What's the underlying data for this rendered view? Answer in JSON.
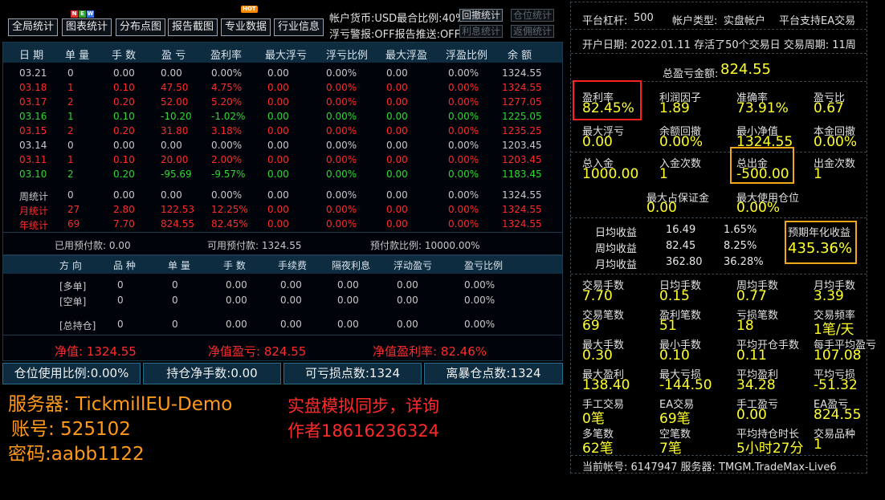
{
  "toolbar": {
    "buttons": [
      "全局统计",
      "图表统计",
      "分布点图",
      "报告截图",
      "专业数据",
      "行业信息"
    ],
    "new_badge": [
      "N",
      "E",
      "W"
    ],
    "hot_badge": "HOT",
    "status1": "帐户货币:USD最合比例:40%",
    "status2": "浮亏警报:OFF报告推送:OFF",
    "btn_rollback": "回撤统计",
    "btn_position": "仓位统计",
    "btn_interest": "利息统计",
    "btn_rebate": "返佣统计"
  },
  "daily": {
    "headers": [
      "日 期",
      "单 量",
      "手 数",
      "盈 亏",
      "盈利率",
      "最大浮亏",
      "浮亏比例",
      "最大浮盈",
      "浮盈比例",
      "余 额"
    ],
    "rows": [
      {
        "date": "03.21",
        "orders": "0",
        "lots": "0.00",
        "pl": "0.00",
        "rate": "0.00%",
        "maxloss": "0.00",
        "lossr": "0.00%",
        "maxprofit": "0.00",
        "profitr": "0.00%",
        "balance": "1324.55",
        "color": "gray"
      },
      {
        "date": "03.18",
        "orders": "1",
        "lots": "0.10",
        "pl": "47.50",
        "rate": "4.75%",
        "maxloss": "0.00",
        "lossr": "0.00%",
        "maxprofit": "0.00",
        "profitr": "0.00%",
        "balance": "1324.55",
        "color": "red"
      },
      {
        "date": "03.17",
        "orders": "2",
        "lots": "0.20",
        "pl": "52.00",
        "rate": "5.20%",
        "maxloss": "0.00",
        "lossr": "0.00%",
        "maxprofit": "0.00",
        "profitr": "0.00%",
        "balance": "1277.05",
        "color": "red"
      },
      {
        "date": "03.16",
        "orders": "1",
        "lots": "0.10",
        "pl": "-10.20",
        "rate": "-1.02%",
        "maxloss": "0.00",
        "lossr": "0.00%",
        "maxprofit": "0.00",
        "profitr": "0.00%",
        "balance": "1225.05",
        "color": "green"
      },
      {
        "date": "03.15",
        "orders": "2",
        "lots": "0.20",
        "pl": "31.80",
        "rate": "3.18%",
        "maxloss": "0.00",
        "lossr": "0.00%",
        "maxprofit": "0.00",
        "profitr": "0.00%",
        "balance": "1235.25",
        "color": "red"
      },
      {
        "date": "03.14",
        "orders": "0",
        "lots": "0.00",
        "pl": "0.00",
        "rate": "0.00%",
        "maxloss": "0.00",
        "lossr": "0.00%",
        "maxprofit": "0.00",
        "profitr": "0.00%",
        "balance": "1203.45",
        "color": "gray"
      },
      {
        "date": "03.11",
        "orders": "1",
        "lots": "0.10",
        "pl": "20.00",
        "rate": "2.00%",
        "maxloss": "0.00",
        "lossr": "0.00%",
        "maxprofit": "0.00",
        "profitr": "0.00%",
        "balance": "1203.45",
        "color": "red"
      },
      {
        "date": "03.10",
        "orders": "2",
        "lots": "0.20",
        "pl": "-95.69",
        "rate": "-9.57%",
        "maxloss": "0.00",
        "lossr": "0.00%",
        "maxprofit": "0.00",
        "profitr": "0.00%",
        "balance": "1183.45",
        "color": "green"
      }
    ],
    "summary": [
      {
        "date": "周统计",
        "orders": "0",
        "lots": "0.00",
        "pl": "0.00",
        "rate": "0.00%",
        "maxloss": "0.00",
        "lossr": "0.00%",
        "maxprofit": "0.00",
        "profitr": "0.00%",
        "balance": "1324.55",
        "color": "gray"
      },
      {
        "date": "月统计",
        "orders": "27",
        "lots": "2.80",
        "pl": "122.53",
        "rate": "12.25%",
        "maxloss": "0.00",
        "lossr": "0.00%",
        "maxprofit": "0.00",
        "profitr": "0.00%",
        "balance": "1324.55",
        "color": "red"
      },
      {
        "date": "年统计",
        "orders": "69",
        "lots": "7.70",
        "pl": "824.55",
        "rate": "82.45%",
        "maxloss": "0.00",
        "lossr": "0.00%",
        "maxprofit": "0.00",
        "profitr": "0.00%",
        "balance": "1324.55",
        "color": "red"
      }
    ],
    "used_prepay": "已用预付款: 0.00",
    "avail_prepay": "可用预付款: 1324.55",
    "prepay_ratio": "预付款比例: 10000.00%"
  },
  "positions": {
    "headers": [
      "方 向",
      "品 种",
      "单 量",
      "手 数",
      "手续费",
      "隔夜利息",
      "浮动盈亏",
      "盈亏比例"
    ],
    "rows": [
      [
        "[多单]",
        "0",
        "0",
        "0.00",
        "0.00",
        "0.00",
        "0.00",
        "0.00%"
      ],
      [
        "[空单]",
        "0",
        "0",
        "0.00",
        "0.00",
        "0.00",
        "0.00",
        "0.00%"
      ],
      [
        "[总持仓]",
        "0",
        "0",
        "0.00",
        "0.00",
        "0.00",
        "0.00",
        "0.00%"
      ]
    ],
    "net_value": "净值: 1324.55",
    "net_pl": "净值盈亏: 824.55",
    "net_rate": "净值盈利率: 82.46%"
  },
  "bottom": {
    "pos_usage": "仓位使用比例:0.00%",
    "net_lots": "持仓净手数:0.00",
    "stop_points": "可亏损点数:1324",
    "blowup_points": "离暴仓点数:1324"
  },
  "overlay": {
    "server": "服务器: TickmillEU-Demo",
    "account": "账号: 525102",
    "password": "密码:aabb1122",
    "promo1": "实盘模拟同步，详询",
    "promo2": "作者18616236324"
  },
  "right": {
    "leverage_label": "平台杠杆:",
    "leverage": "500",
    "acct_type_label": "帐户类型:",
    "acct_type": "实盘帐户",
    "ea_support": "平台支持EA交易",
    "open_date": "开户日期: 2022.01.11 存活了50个交易日 交易周期: 11周",
    "total_profit_label": "总盈亏金额:",
    "total_profit": "824.55",
    "grid1": [
      {
        "label": "盈利率",
        "value": "82.45%"
      },
      {
        "label": "利润因子",
        "value": "1.89"
      },
      {
        "label": "准确率",
        "value": "73.91%"
      },
      {
        "label": "盈亏比",
        "value": "0.67"
      },
      {
        "label": "最大浮亏",
        "value": "0.00"
      },
      {
        "label": "余额回撤",
        "value": "0.00%"
      },
      {
        "label": "最小净值",
        "value": "1324.55"
      },
      {
        "label": "本金回撤",
        "value": "0.00%"
      },
      {
        "label": "总入金",
        "value": "1000.00"
      },
      {
        "label": "入金次数",
        "value": "1"
      },
      {
        "label": "总出金",
        "value": "-500.00"
      },
      {
        "label": "出金次数",
        "value": "1"
      }
    ],
    "margin_label": "最大占保证金",
    "margin": "0.00",
    "max_pos_label": "最大使用仓位",
    "max_pos": "0.00%",
    "income": [
      {
        "label": "日均收益",
        "amount": "16.49",
        "pct": "1.65%"
      },
      {
        "label": "周均收益",
        "amount": "82.45",
        "pct": "8.25%"
      },
      {
        "label": "月均收益",
        "amount": "362.80",
        "pct": "36.28%"
      }
    ],
    "annual_label": "预期年化收益",
    "annual": "435.36%",
    "grid2": [
      {
        "label": "交易手数",
        "value": "7.70"
      },
      {
        "label": "日均手数",
        "value": "0.15"
      },
      {
        "label": "周均手数",
        "value": "0.77"
      },
      {
        "label": "月均手数",
        "value": "3.39"
      },
      {
        "label": "交易笔数",
        "value": "69"
      },
      {
        "label": "盈利笔数",
        "value": "51"
      },
      {
        "label": "亏损笔数",
        "value": "18"
      },
      {
        "label": "交易频率",
        "value": "1笔/天"
      },
      {
        "label": "最大手数",
        "value": "0.30"
      },
      {
        "label": "最小手数",
        "value": "0.10"
      },
      {
        "label": "平均开仓手数",
        "value": "0.11"
      },
      {
        "label": "每手平均盈亏",
        "value": "107.08"
      },
      {
        "label": "最大盈利",
        "value": "138.40"
      },
      {
        "label": "最大亏损",
        "value": "-144.50"
      },
      {
        "label": "平均盈利",
        "value": "34.28"
      },
      {
        "label": "平均亏损",
        "value": "-51.32"
      },
      {
        "label": "手工交易",
        "value": "0笔"
      },
      {
        "label": "EA交易",
        "value": "69笔"
      },
      {
        "label": "手工盈亏",
        "value": "0.00"
      },
      {
        "label": "EA盈亏",
        "value": "824.55"
      },
      {
        "label": "多笔数",
        "value": "62笔"
      },
      {
        "label": "空笔数",
        "value": "7笔"
      },
      {
        "label": "平均持仓时长",
        "value": "5小时27分"
      },
      {
        "label": "交易品种",
        "value": "1"
      }
    ],
    "footer": "当前帐号: 6147947 服务器: TMGM.TradeMax-Live6"
  },
  "colors": {
    "positive": "#ff2b2b",
    "negative": "#2ed82e",
    "value_yellow": "#ffff2a",
    "header_bg": "#0d2c40",
    "highlight_red": "#ff2020",
    "highlight_gold": "#f0a818"
  }
}
